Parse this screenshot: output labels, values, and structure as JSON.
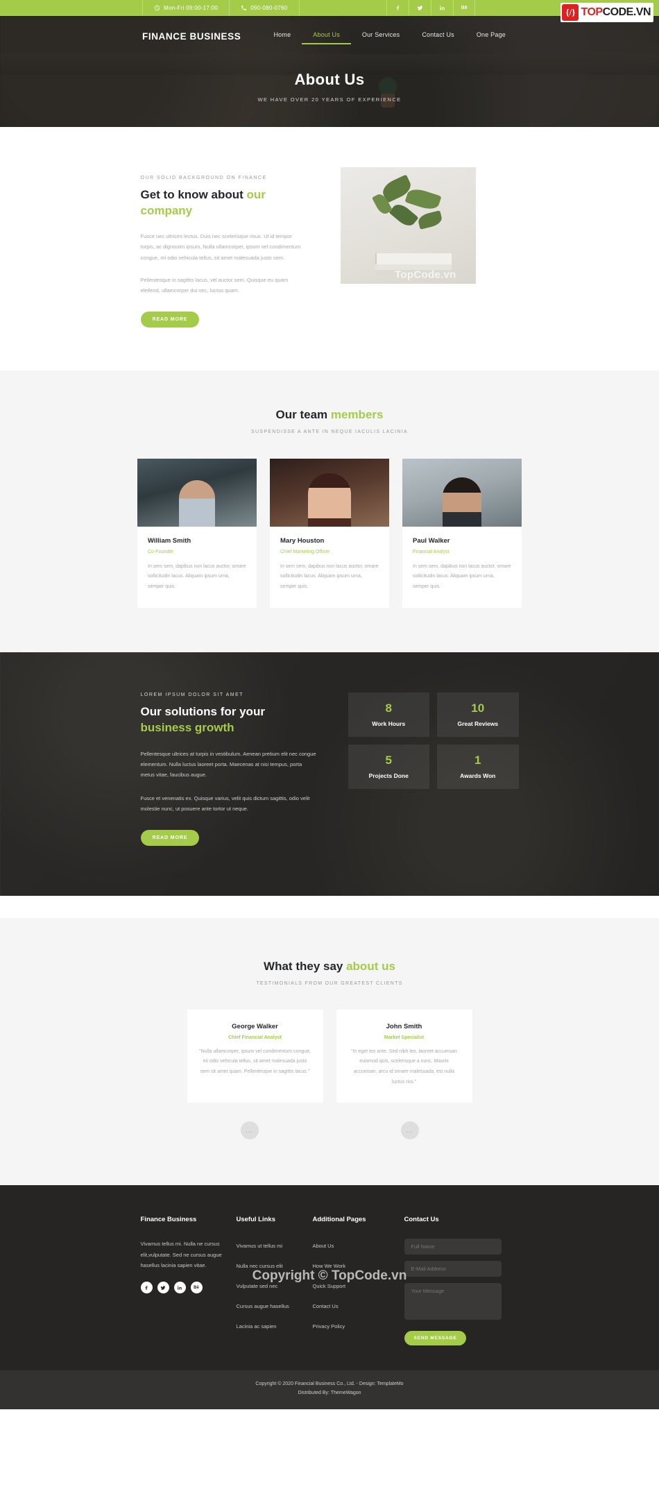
{
  "topbar": {
    "hours": "Mon-Fri 09:00-17:00",
    "phone": "090-080-0760",
    "socials": [
      {
        "name": "facebook-icon",
        "label": "f"
      },
      {
        "name": "twitter-icon",
        "label": "t"
      },
      {
        "name": "linkedin-icon",
        "label": "in"
      },
      {
        "name": "behance-icon",
        "label": "Be"
      }
    ]
  },
  "watermark_logo": {
    "mark": "{/}",
    "top": "TOP",
    "code": "CODE",
    "vn": ".VN"
  },
  "nav": {
    "brand": "FINANCE BUSINESS",
    "links": [
      {
        "label": "Home",
        "active": false
      },
      {
        "label": "About Us",
        "active": true
      },
      {
        "label": "Our Services",
        "active": false
      },
      {
        "label": "Contact Us",
        "active": false
      },
      {
        "label": "One Page",
        "active": false
      }
    ]
  },
  "hero": {
    "title": "About Us",
    "subtitle": "WE HAVE OVER 20 YEARS OF EXPERIENCE"
  },
  "about": {
    "eyebrow": "OUR SOLID BACKGROUND ON FINANCE",
    "title_main": "Get to know about ",
    "title_accent_1": "our",
    "title_accent_2": "company",
    "paragraph_1": "Fusce nec ultrices lectus. Duis nec scelerisque risus. Ut id tempor turpis, ac dignissim ipsum. Nulla ullamcorper, ipsum vel condimentum congue, mi odio vehicula tellus, sit amet malesuada justo sem.",
    "paragraph_2": "Pellentesque in sagittis lacus, vel auctor sem. Quisque eu quam eleifend, ullamcorper dui nec, luctus quam.",
    "button": "READ MORE",
    "image_watermark": "TopCode.vn"
  },
  "team": {
    "title_main": "Our team ",
    "title_accent": "members",
    "subtitle": "SUSPENDISSE A ANTE IN NEQUE IACULIS LACINIA",
    "members": [
      {
        "name": "William Smith",
        "role": "Co-Founder",
        "desc": "In sem sem, dapibus non lacus auctor, ornare sollicitudin lacus. Aliquam ipsum urna, semper quis."
      },
      {
        "name": "Mary Houston",
        "role": "Chief Marketing Officer",
        "desc": "In sem sem, dapibus non lacus auctor, ornare sollicitudin lacus. Aliquam ipsum urna, semper quis."
      },
      {
        "name": "Paul Walker",
        "role": "Financial Analyst",
        "desc": "In sem sem, dapibus non lacus auctor, ornare sollicitudin lacus. Aliquam ipsum urna, semper quis."
      }
    ]
  },
  "solutions": {
    "eyebrow": "LOREM IPSUM DOLOR SIT AMET",
    "title_main": "Our solutions for your",
    "title_accent": "business growth",
    "paragraph_1": "Pellentesque ultrices at turpis in vestibulum. Aenean pretium elit nec congue elementum. Nulla luctus laoreet porta. Maecenas at nisi tempus, porta metus vitae, faucibus augue.",
    "paragraph_2": "Fusce et venenatis ex. Quisque varius, velit quis dictum sagittis, odio velit molestie nunc, ut posuere ante tortor ut neque.",
    "button": "READ MORE",
    "stats": [
      {
        "number": "8",
        "label": "Work Hours"
      },
      {
        "number": "10",
        "label": "Great Reviews"
      },
      {
        "number": "5",
        "label": "Projects Done"
      },
      {
        "number": "1",
        "label": "Awards Won"
      }
    ]
  },
  "testimonials": {
    "title_main": "What they say ",
    "title_accent": "about us",
    "subtitle": "TESTIMONIALS FROM OUR GREATEST CLIENTS",
    "items": [
      {
        "name": "George Walker",
        "role": "Chief Financial Analyst",
        "quote": "\"Nulla ullamcorper, ipsum vel condimentum congue, mi odio vehicula tellus, sit amet malesuada justo sem sit amet quam. Pellentesque in sagittis lacus.\""
      },
      {
        "name": "John Smith",
        "role": "Market Specialist",
        "quote": "\"In eget leo ante. Sed nibh leo, laoreet accumsan euismod quis, scelerisque a nunc. Mauris accumsan, arcu id ornare malesuada, est nulla luctus nisi.\""
      }
    ],
    "prev_dot": "...",
    "next_dot": "..."
  },
  "footer": {
    "col1": {
      "heading": "Finance Business",
      "text": "Vivamus tellus mi. Nulla ne cursus elit,vulputate. Sed ne cursus augue hasellus lacinia sapien vitae.",
      "socials": [
        {
          "name": "facebook-icon",
          "label": "f"
        },
        {
          "name": "twitter-icon",
          "label": "t"
        },
        {
          "name": "linkedin-icon",
          "label": "in"
        },
        {
          "name": "behance-icon",
          "label": "Be"
        }
      ]
    },
    "col2": {
      "heading": "Useful Links",
      "links": [
        "Vivamus ut tellus mi",
        "Nulla nec cursus elit",
        "Vulputate sed nec",
        "Cursus augue hasellus",
        "Lacinia ac sapien"
      ]
    },
    "col3": {
      "heading": "Additional Pages",
      "links": [
        "About Us",
        "How We Work",
        "Quick Support",
        "Contact Us",
        "Privacy Policy"
      ]
    },
    "col4": {
      "heading": "Contact Us",
      "name_placeholder": "Full Name",
      "email_placeholder": "E-Mail Address",
      "message_placeholder": "Your Message",
      "send_button": "SEND MESSAGE"
    },
    "watermark": "Copyright © TopCode.vn",
    "copyright_line1": "Copyright © 2020 Financial Business Co., Ltd. - Design: TemplateMo",
    "copyright_line2": "Distributed By: ThemeWagon"
  },
  "colors": {
    "accent": "#a4cc48",
    "dark": "#262523",
    "light_bg": "#f5f5f5",
    "brand_red": "#e02020"
  }
}
